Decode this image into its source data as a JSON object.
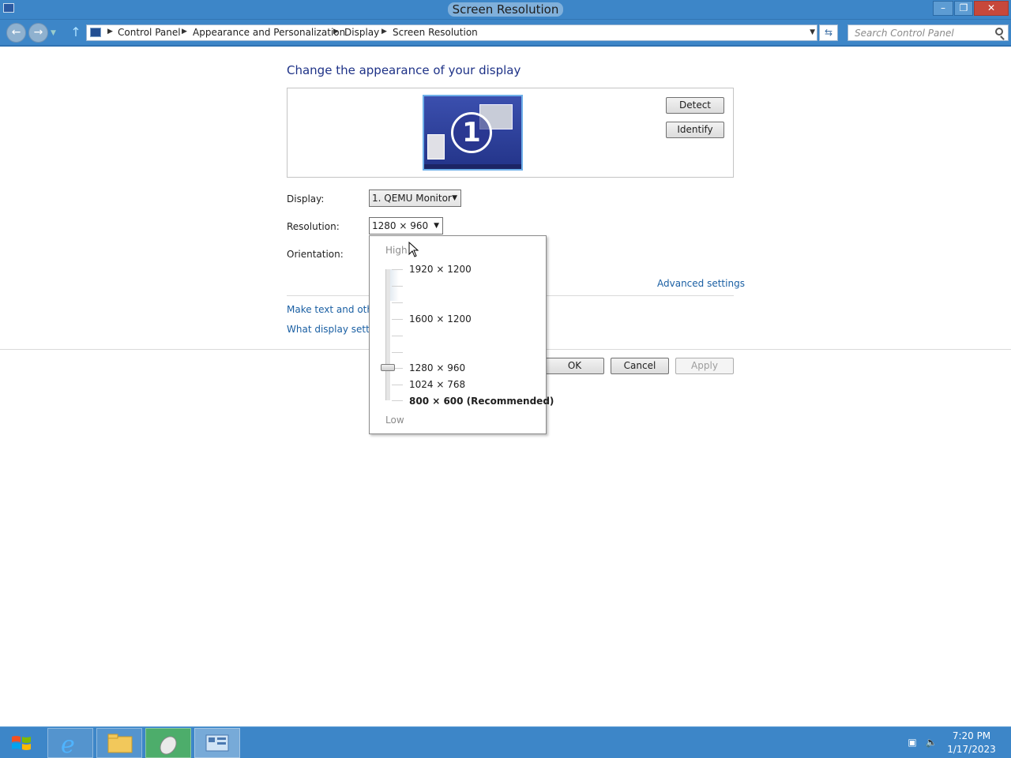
{
  "window": {
    "title": "Screen Resolution",
    "minimize_icon": "minimize-icon",
    "maximize_icon": "restore-icon",
    "close_icon": "close-icon"
  },
  "nav": {
    "breadcrumbs": [
      "Control Panel",
      "Appearance and Personalization",
      "Display",
      "Screen Resolution"
    ],
    "search_placeholder": "Search Control Panel"
  },
  "content": {
    "heading": "Change the appearance of your display",
    "monitor_number": "1",
    "detect_label": "Detect",
    "identify_label": "Identify",
    "display_label": "Display:",
    "display_value": "1. QEMU Monitor",
    "resolution_label": "Resolution:",
    "resolution_value": "1280 × 960",
    "orientation_label": "Orientation:",
    "advanced_link": "Advanced settings",
    "link_text_size": "Make text and other",
    "link_display_settings": "What display setting",
    "ok_label": "OK",
    "cancel_label": "Cancel",
    "apply_label": "Apply"
  },
  "resolution_popup": {
    "high_label": "High",
    "low_label": "Low",
    "options": [
      "1920 × 1200",
      "1600 × 1200",
      "1280 × 960",
      "1024 × 768",
      "800 × 600 (Recommended)"
    ],
    "selected": "1280 × 960"
  },
  "taskbar": {
    "time": "7:20 PM",
    "date": "1/17/2023"
  },
  "colors": {
    "accent": "#3d86c8",
    "link": "#1a5fa3",
    "heading": "#1e3287"
  }
}
